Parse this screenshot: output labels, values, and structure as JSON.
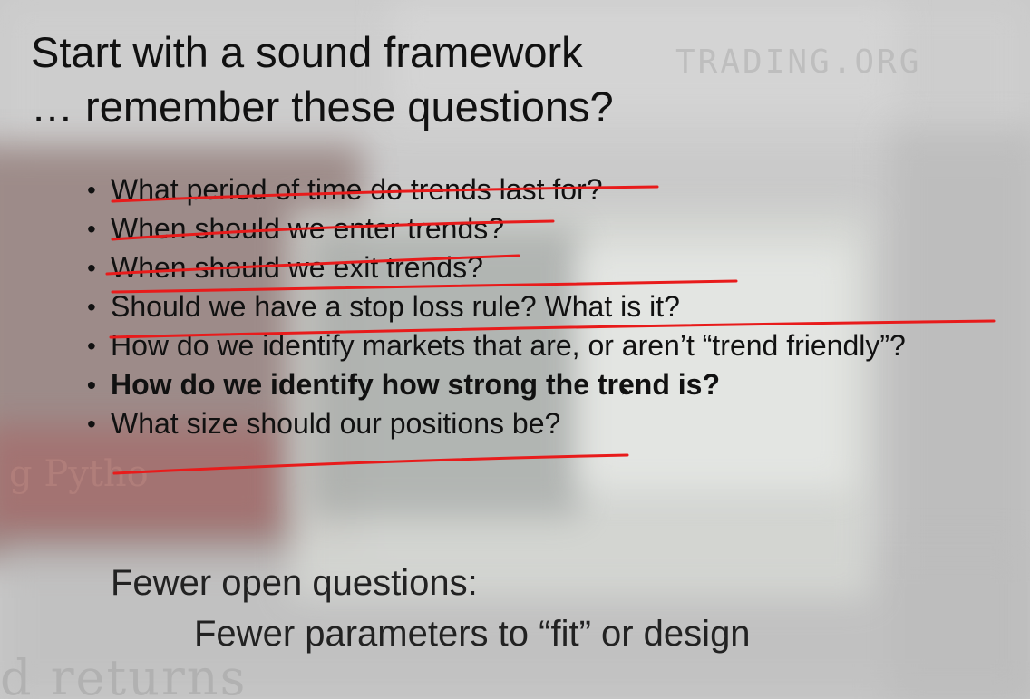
{
  "slide": {
    "title_line1": "Start with a sound framework",
    "title_line2": "… remember these questions?",
    "questions": [
      {
        "text": "What period of time do trends last for?",
        "struck": true
      },
      {
        "text": "When should we enter trends?",
        "struck": true
      },
      {
        "text": "When should we exit trends?",
        "struck": true
      },
      {
        "text": "Should we have a stop loss rule? What is it?",
        "struck": false
      },
      {
        "text": "How do we identify markets that are, or aren’t “trend friendly”?",
        "struck": true
      },
      {
        "text": "How do we identify how strong the trend is?",
        "struck": false,
        "bold": true
      },
      {
        "text": "What size should our positions be?",
        "struck": true
      }
    ],
    "footer_line1": "Fewer open questions:",
    "footer_line2": "Fewer parameters to “fit” or design"
  },
  "background": {
    "watermark": "TRADING.ORG",
    "returns_text": "d returns",
    "book_text": "g Pytho"
  },
  "colors": {
    "annotation": "#e81b1b",
    "text": "#111111"
  }
}
